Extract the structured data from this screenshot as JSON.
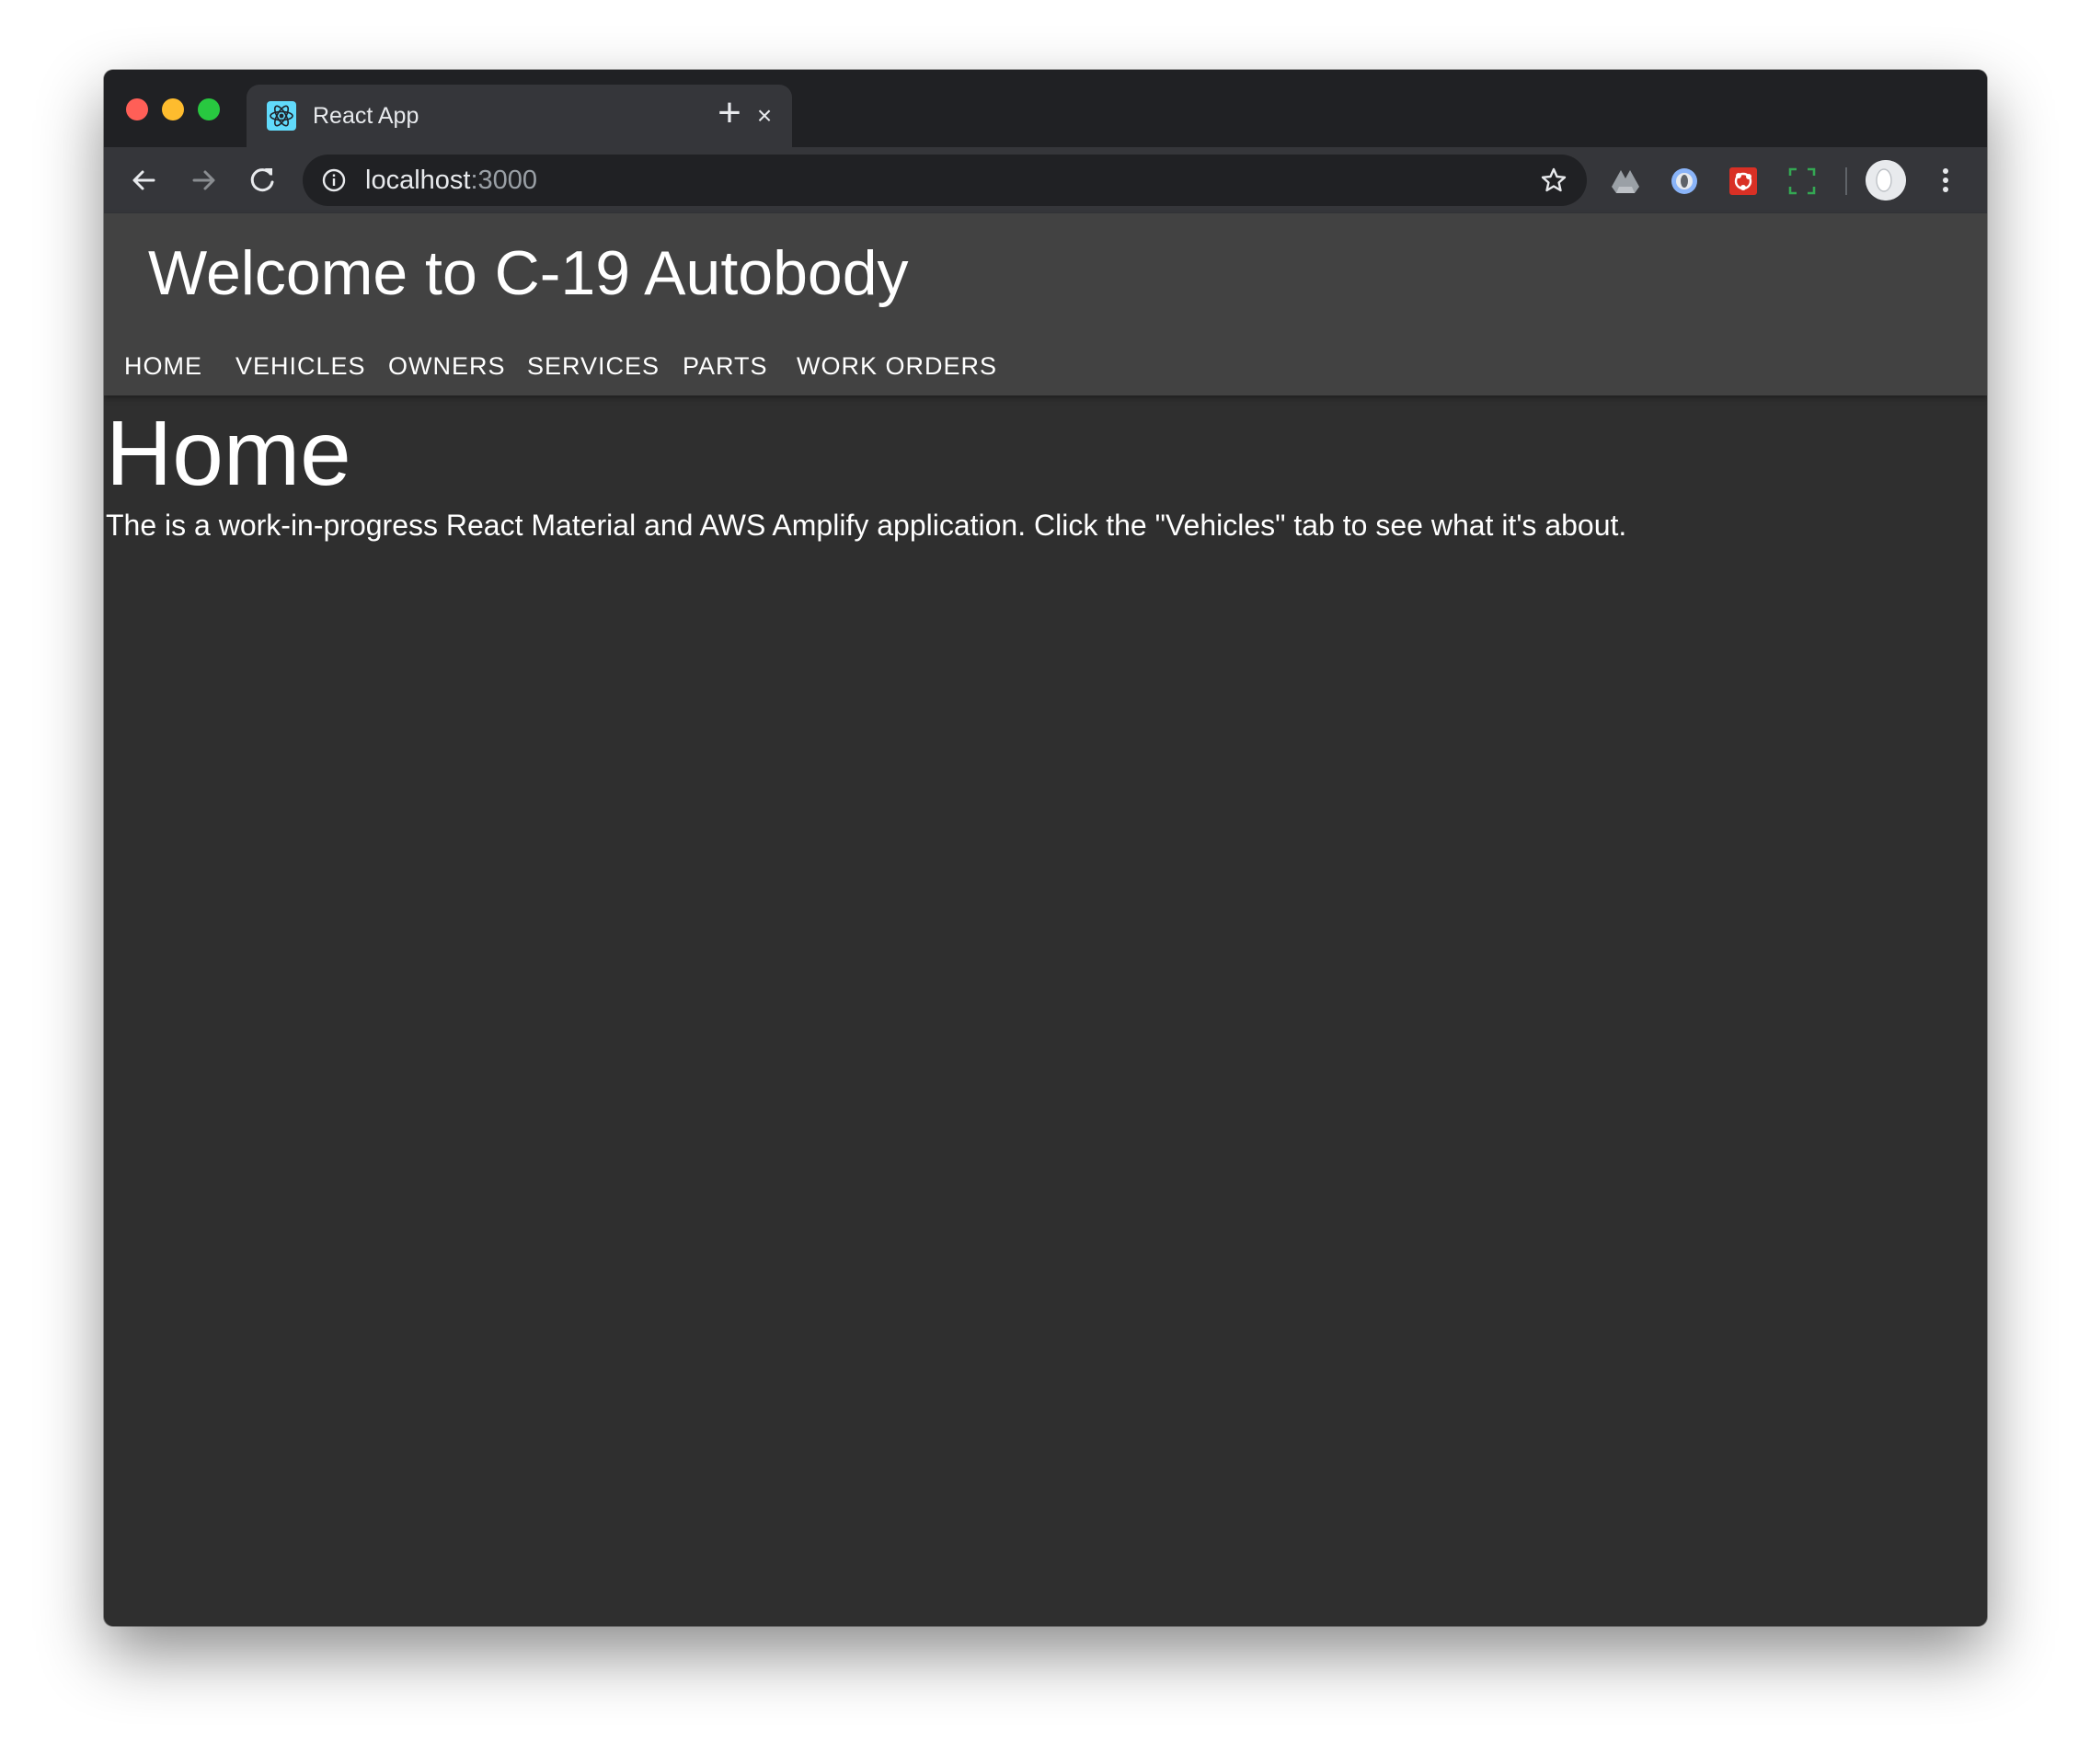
{
  "browser": {
    "tab": {
      "title": "React App",
      "favicon": "react-logo-icon",
      "close_glyph": "×"
    },
    "new_tab_glyph": "+",
    "address": {
      "host": "localhost",
      "port": ":3000"
    },
    "icons": {
      "back": "arrow-left-icon",
      "forward": "arrow-right-icon",
      "reload": "reload-icon",
      "site_info": "info-icon",
      "bookmark": "star-icon",
      "extensions": [
        "google-drive-icon",
        "circle-extension-icon",
        "red-extension-icon",
        "bracket-extension-icon"
      ],
      "profile": "avatar-icon",
      "menu": "kebab-menu-icon"
    }
  },
  "app": {
    "title": "Welcome to C-19 Autobody",
    "nav": [
      "HOME",
      "VEHICLES",
      "OWNERS",
      "SERVICES",
      "PARTS",
      "WORK ORDERS"
    ]
  },
  "page": {
    "heading": "Home",
    "body": "The is a work-in-progress React Material and AWS Amplify application. Click the \"Vehicles\" tab to see what it's about."
  },
  "colors": {
    "app_bar": "#424242",
    "background": "#2f2f2f",
    "text": "#ffffff",
    "browser_chrome": "#35363a",
    "tab_strip": "#202124"
  }
}
